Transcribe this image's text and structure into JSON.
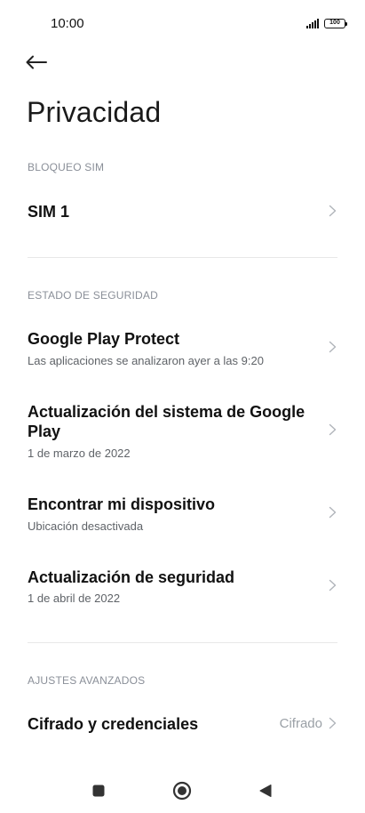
{
  "status_bar": {
    "time": "10:00",
    "battery": "100"
  },
  "page": {
    "title": "Privacidad"
  },
  "sections": {
    "sim_lock": {
      "header": "BLOQUEO SIM",
      "items": [
        {
          "title": "SIM 1"
        }
      ]
    },
    "security_status": {
      "header": "ESTADO DE SEGURIDAD",
      "items": [
        {
          "title": "Google Play Protect",
          "subtitle": "Las aplicaciones se analizaron ayer a las 9:20"
        },
        {
          "title_line1": "Actualización del sistema de Google",
          "title_line2": "Play",
          "subtitle": "1 de marzo de 2022"
        },
        {
          "title": "Encontrar mi dispositivo",
          "subtitle": "Ubicación desactivada"
        },
        {
          "title": "Actualización de seguridad",
          "subtitle": "1 de abril de 2022"
        }
      ]
    },
    "advanced": {
      "header": "AJUSTES AVANZADOS",
      "items": [
        {
          "title": "Cifrado y credenciales",
          "value": "Cifrado"
        }
      ]
    }
  },
  "icons": {
    "back": "arrow-left-icon",
    "chevron": "chevron-right-icon",
    "nav_recents": "square-icon",
    "nav_home": "circle-icon",
    "nav_back": "triangle-left-icon"
  },
  "colors": {
    "text_primary": "#111111",
    "text_secondary": "#5f6368",
    "section_header": "#8a8f98",
    "chevron": "#b0b4ba",
    "divider": "#e8e8e8"
  }
}
